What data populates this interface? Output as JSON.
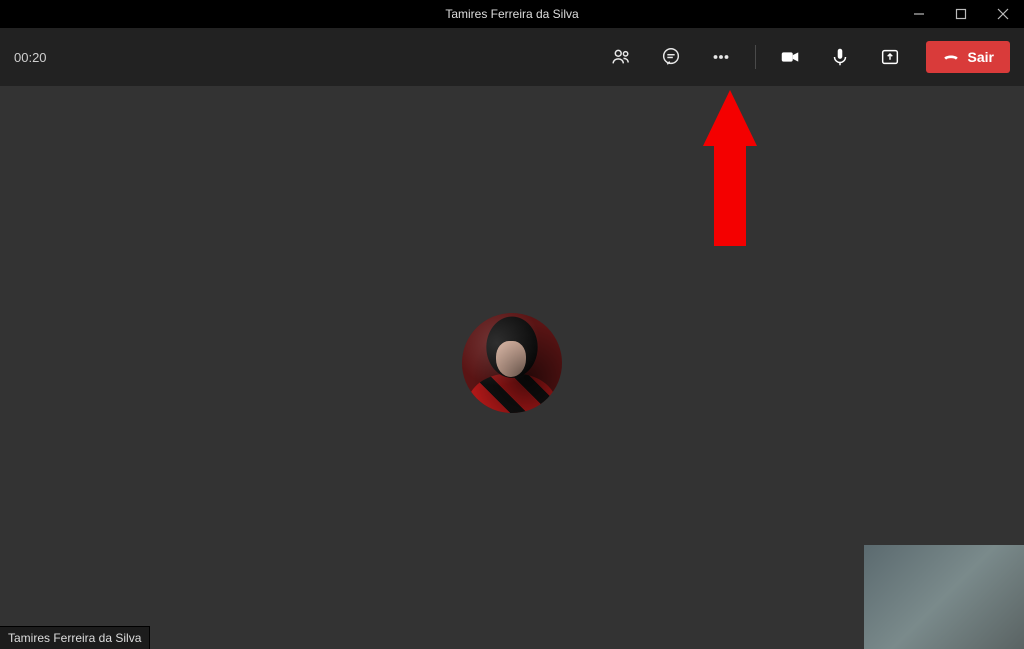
{
  "window": {
    "title": "Tamires Ferreira da Silva",
    "controls": {
      "minimize": "minimize-icon",
      "maximize": "maximize-icon",
      "close": "close-icon"
    }
  },
  "call": {
    "timer": "00:20",
    "buttons": {
      "people": "people-icon",
      "chat": "chat-icon",
      "more": "more-icon",
      "camera": "camera-icon",
      "mic": "mic-icon",
      "share": "share-icon"
    },
    "leaveLabel": "Sair"
  },
  "participant": {
    "name": "Tamires Ferreira da Silva"
  },
  "colors": {
    "leaveButton": "#d93b3a",
    "annotationArrow": "#f40000",
    "toolbar": "#222222",
    "stage": "#333333"
  },
  "annotation": {
    "type": "arrow",
    "pointsTo": "more-actions-button"
  }
}
